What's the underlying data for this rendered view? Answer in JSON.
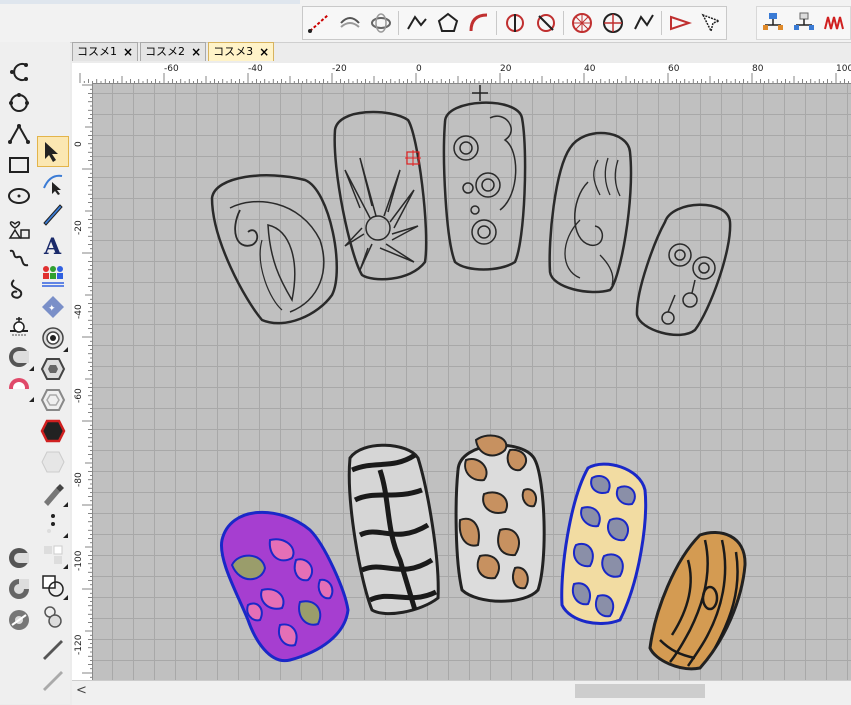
{
  "tabs": [
    {
      "label": "コスメ1",
      "close": "×"
    },
    {
      "label": "コスメ2",
      "close": "×"
    },
    {
      "label": "コスメ3",
      "close": "×"
    }
  ],
  "ruler": {
    "h_ticks": [
      "-60",
      "-40",
      "-20",
      "0",
      "20",
      "40",
      "60",
      "80",
      "100"
    ],
    "v_ticks": [
      "0",
      "-20",
      "-40",
      "-60",
      "-80",
      "-100",
      "-120"
    ]
  },
  "scrollbar": {
    "left_arrow": "<"
  },
  "icons": {
    "top_toolbar": [
      "line-tool-icon",
      "rotate-stitch-icon",
      "rotate-3d-icon",
      "polyline-icon",
      "polygon-icon",
      "curve-icon",
      "split-icon",
      "reshape-icon",
      "radial-icon",
      "radial-fill-icon",
      "angle-icon",
      "arrow-icon",
      "select-points-icon",
      "network-a-icon",
      "network-b-icon",
      "zigzag-icon"
    ],
    "left_col1": [
      "curve-open-icon",
      "curve-closed-icon",
      "curve-point-icon",
      "rectangle-icon",
      "ellipse-icon",
      "shapes-icon",
      "freehand-icon",
      "spiral-icon",
      "applique-icon",
      "stitch-type-icon",
      "sunflower-icon"
    ],
    "left_col1_bottom": [
      "circle-fill-icon",
      "circle-outline-icon",
      "circle-dots-icon"
    ],
    "left_col2": [
      "select-arrow-icon",
      "node-edit-icon",
      "knife-icon",
      "text-A-icon",
      "team-names-icon",
      "monogram-icon",
      "concentric-icon",
      "hexagon-outline-icon",
      "hexagon-offset-icon",
      "hexagon-fill-icon",
      "hexagon-soft-icon",
      "pen-icon",
      "dots-icon",
      "grid-icon",
      "shape-combine-icon",
      "stamp-icon",
      "needle-icon",
      "needle-grey-icon"
    ]
  },
  "colors": {
    "canvas": "#c0c0c0",
    "purple_leopard": "#a63ed0",
    "pink_spots": "#e56fb6",
    "tan": "#c79160",
    "blue_outline": "#1a28c8",
    "beige": "#f2dca2",
    "wood": "#d49b52"
  }
}
